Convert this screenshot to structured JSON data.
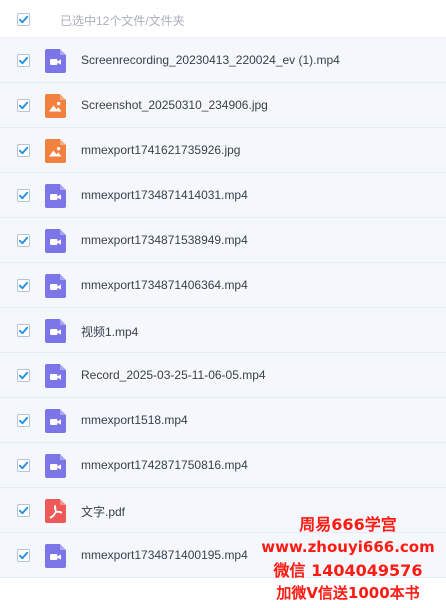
{
  "header": {
    "selection_text": "已选中12个文件/文件夹",
    "checked": true
  },
  "files": [
    {
      "name": "Screenrecording_20230413_220024_ev (1).mp4",
      "type": "video",
      "icon": "video-file-icon",
      "checked": true
    },
    {
      "name": "Screenshot_20250310_234906.jpg",
      "type": "image",
      "icon": "image-file-icon",
      "checked": true
    },
    {
      "name": "mmexport1741621735926.jpg",
      "type": "image",
      "icon": "image-file-icon",
      "checked": true
    },
    {
      "name": "mmexport1734871414031.mp4",
      "type": "video",
      "icon": "video-file-icon",
      "checked": true
    },
    {
      "name": "mmexport1734871538949.mp4",
      "type": "video",
      "icon": "video-file-icon",
      "checked": true
    },
    {
      "name": "mmexport1734871406364.mp4",
      "type": "video",
      "icon": "video-file-icon",
      "checked": true
    },
    {
      "name": "视频1.mp4",
      "type": "video",
      "icon": "video-file-icon",
      "checked": true
    },
    {
      "name": "Record_2025-03-25-11-06-05.mp4",
      "type": "video",
      "icon": "video-file-icon",
      "checked": true
    },
    {
      "name": "mmexport1518.mp4",
      "type": "video",
      "icon": "video-file-icon",
      "checked": true
    },
    {
      "name": "mmexport1742871750816.mp4",
      "type": "video",
      "icon": "video-file-icon",
      "checked": true
    },
    {
      "name": "文字.pdf",
      "type": "pdf",
      "icon": "pdf-file-icon",
      "checked": true
    },
    {
      "name": "mmexport1734871400195.mp4",
      "type": "video",
      "icon": "video-file-icon",
      "checked": true
    }
  ],
  "watermark": {
    "line1": "周易666学宫",
    "line2": "www.zhouyi666.com",
    "line3": "微信 1404049576",
    "line4": "加微V信送1000本书"
  },
  "colors": {
    "checkbox_check": "#1e8fe6",
    "video_icon": "#7b75e8",
    "image_icon": "#f2803f",
    "pdf_icon": "#ee5a57",
    "row_background": "#f4f8fd",
    "watermark": "#ff1a12"
  }
}
